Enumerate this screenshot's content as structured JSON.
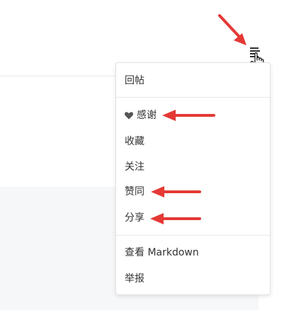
{
  "menu": {
    "trigger_icon": "menu-icon",
    "items": [
      {
        "label": "回帖"
      },
      {
        "label": "感谢",
        "icon": "heart-icon"
      },
      {
        "label": "收藏"
      },
      {
        "label": "关注"
      },
      {
        "label": "赞同"
      },
      {
        "label": "分享"
      },
      {
        "label": "查看 Markdown"
      },
      {
        "label": "举报"
      }
    ]
  },
  "colors": {
    "annotation_arrow": "#e53935",
    "menu_text": "#333333",
    "panel_bg": "#f6f7f9"
  }
}
